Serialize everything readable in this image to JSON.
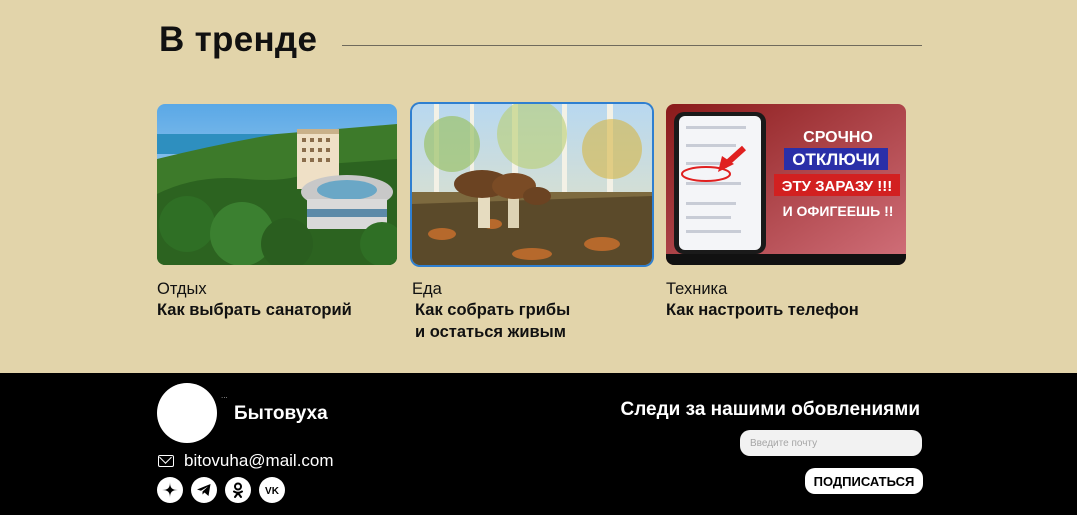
{
  "trending": {
    "title": "В тренде",
    "cards": [
      {
        "category": "Отдых",
        "title": "Как выбрать санаторий",
        "image": "sanatorium-seaside-photo"
      },
      {
        "category": "Еда",
        "title": "Как  собрать грибы\nи остаться живым",
        "image": "mushrooms-forest-photo"
      },
      {
        "category": "Техника",
        "title": "Как настроить телефон",
        "image": "phone-settings-thumbnail"
      }
    ],
    "thumbnail_text": {
      "line1": "СРОЧНО",
      "line2": "ОТКЛЮЧИ",
      "line3": "ЭТУ ЗАРАЗУ !!!",
      "line4": "И ОФИГЕЕШЬ !!"
    }
  },
  "footer": {
    "brand": "Бытовуха",
    "email": "bitovuha@mail.com",
    "socials": [
      "zen-icon",
      "telegram-icon",
      "odnoklassniki-icon",
      "vk-icon"
    ],
    "follow_title": "Следи за нашими обовлениями",
    "email_placeholder": "Введите почту",
    "subscribe_label": "ПОДПИСАТЬСЯ"
  },
  "colors": {
    "background": "#e2d4aa",
    "footer": "#000000",
    "accent": "#2f7fd0"
  }
}
